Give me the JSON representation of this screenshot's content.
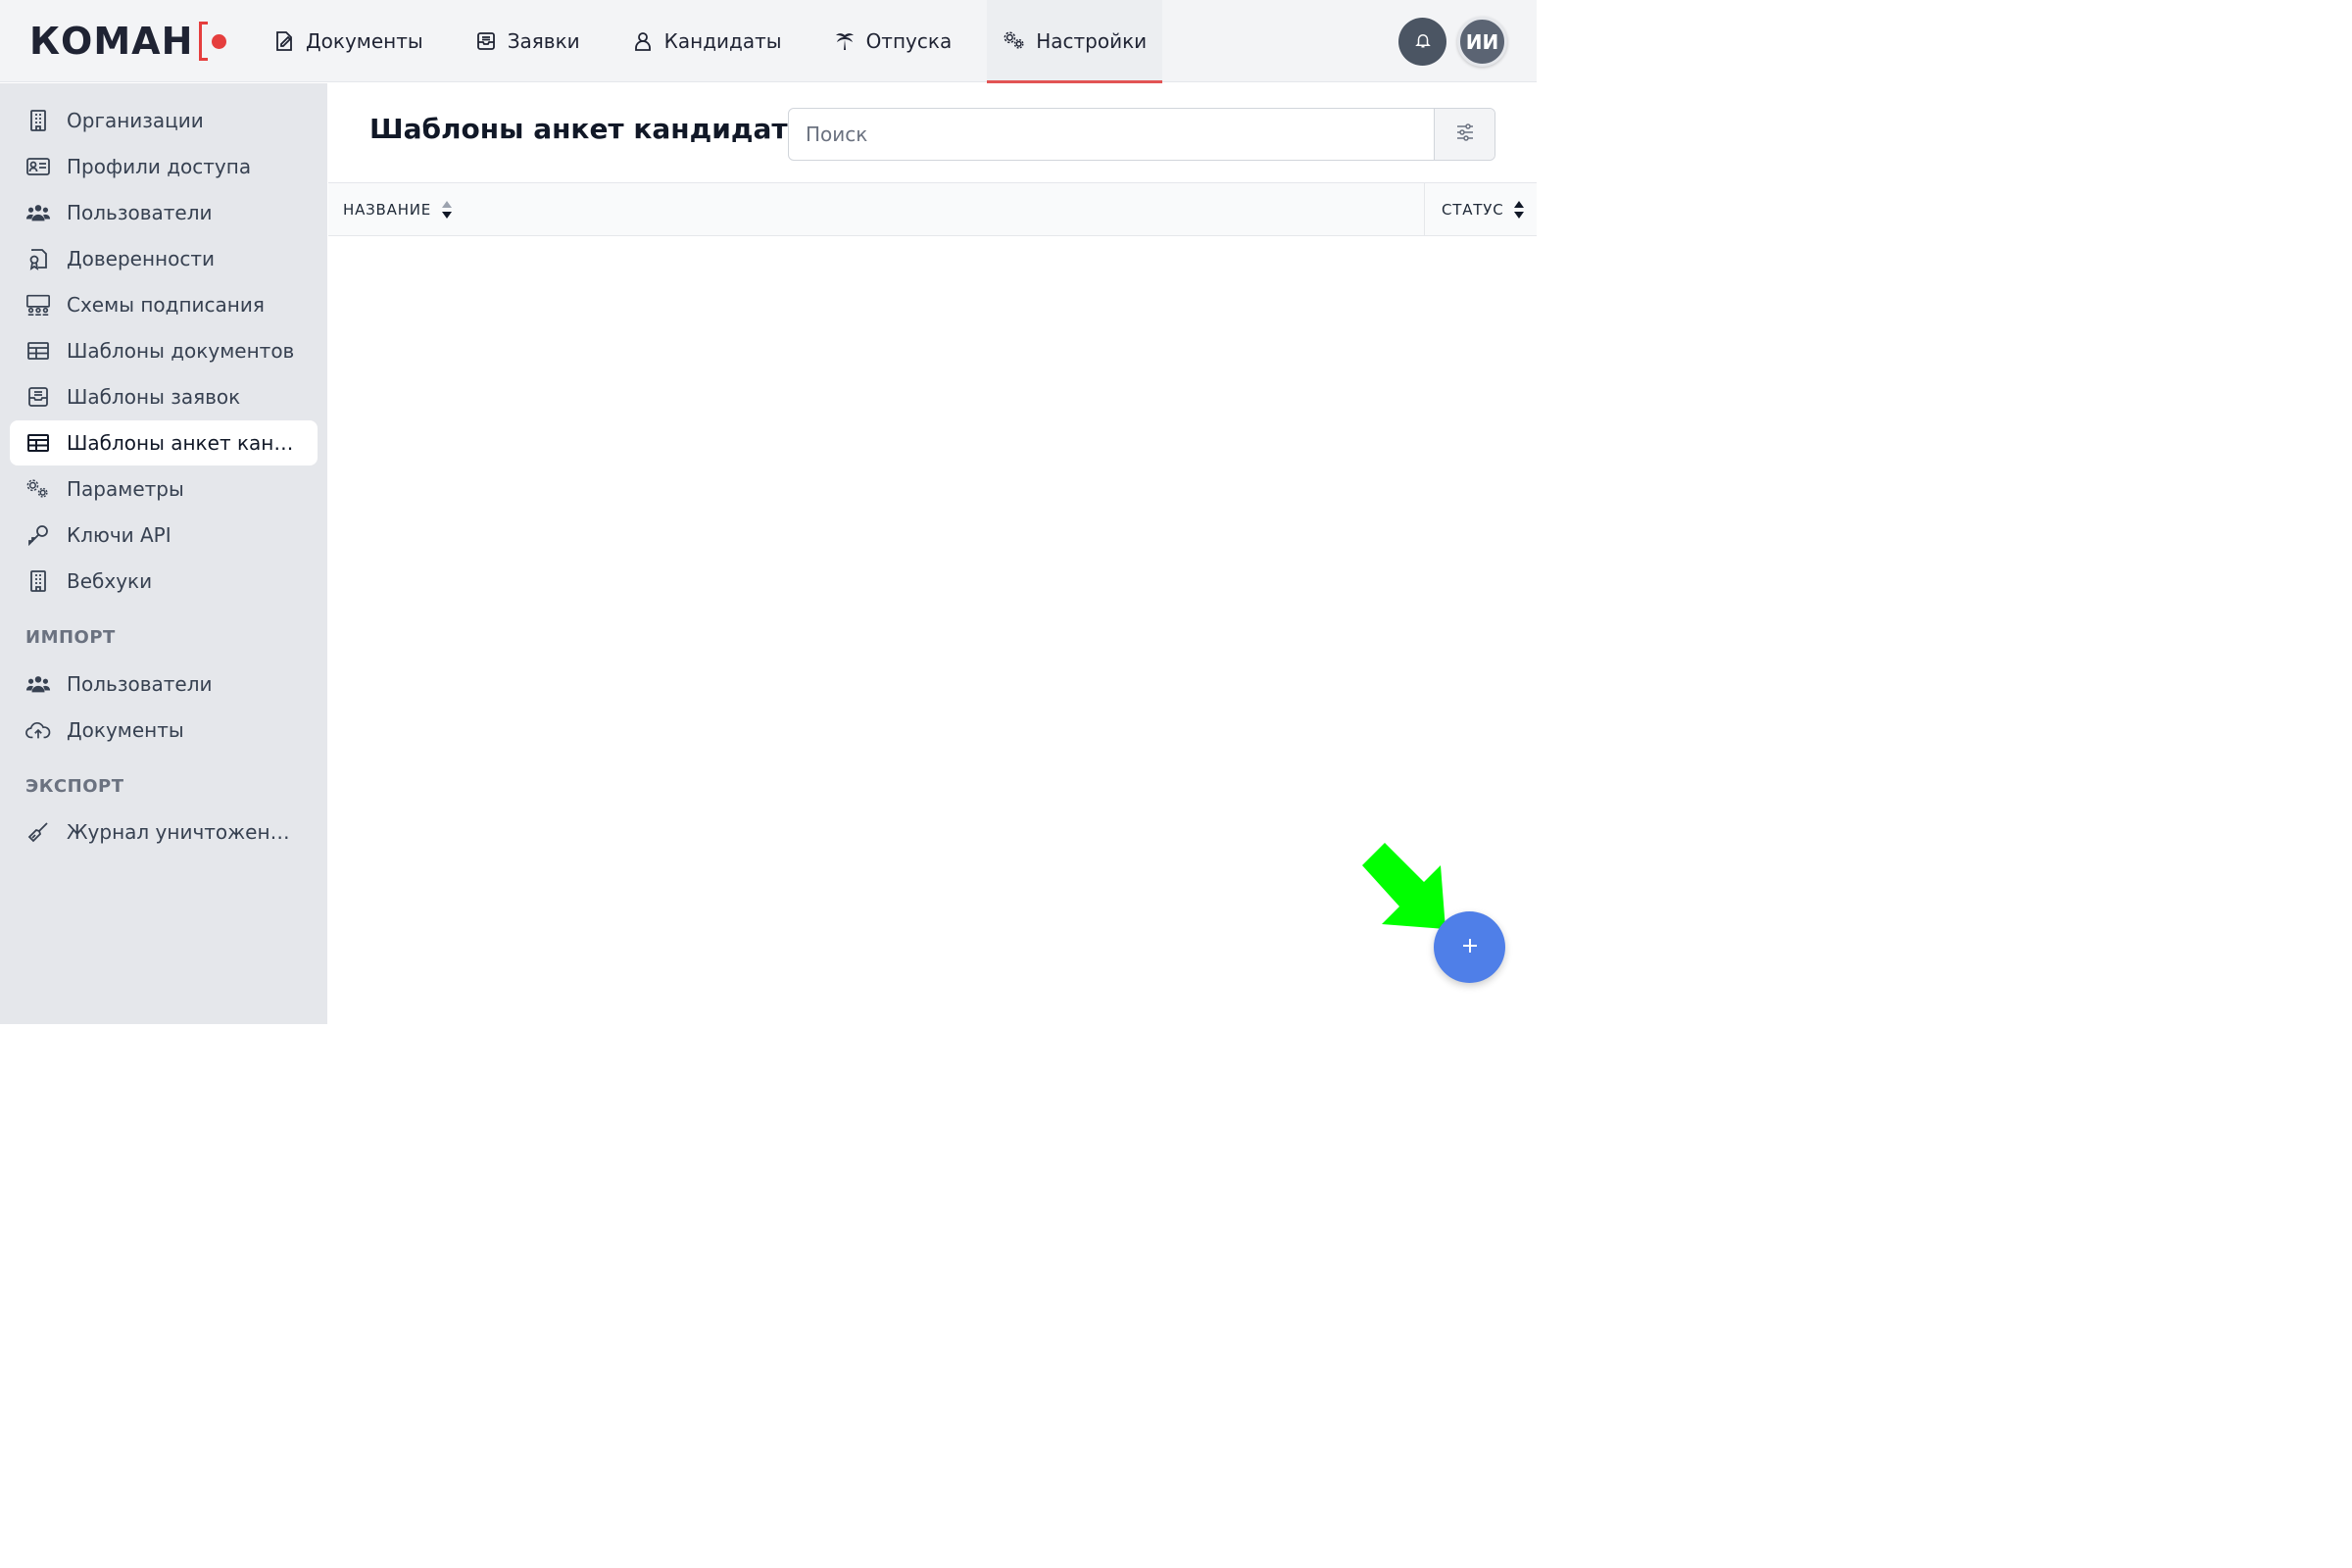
{
  "app": {
    "logo_text": "КОМАН"
  },
  "header": {
    "nav": [
      {
        "label": "Документы",
        "icon": "document-edit-icon"
      },
      {
        "label": "Заявки",
        "icon": "inbox-icon"
      },
      {
        "label": "Кандидаты",
        "icon": "candidate-icon"
      },
      {
        "label": "Отпуска",
        "icon": "palm-tree-icon"
      },
      {
        "label": "Настройки",
        "icon": "settings-gears-icon",
        "active": true
      }
    ],
    "avatar_initials": "ИИ"
  },
  "sidebar": {
    "items": [
      {
        "label": "Организации",
        "icon": "building-icon"
      },
      {
        "label": "Профили доступа",
        "icon": "id-card-icon"
      },
      {
        "label": "Пользователи",
        "icon": "users-icon"
      },
      {
        "label": "Доверенности",
        "icon": "certificate-icon"
      },
      {
        "label": "Схемы подписания",
        "icon": "signing-scheme-icon"
      },
      {
        "label": "Шаблоны документов",
        "icon": "table-icon"
      },
      {
        "label": "Шаблоны заявок",
        "icon": "inbox-icon"
      },
      {
        "label": "Шаблоны анкет кандидатов",
        "icon": "table-icon",
        "active": true
      },
      {
        "label": "Параметры",
        "icon": "gears-icon"
      },
      {
        "label": "Ключи API",
        "icon": "key-icon"
      },
      {
        "label": "Вебхуки",
        "icon": "building-icon"
      }
    ],
    "import_title": "ИМПОРТ",
    "import_items": [
      {
        "label": "Пользователи",
        "icon": "users-icon"
      },
      {
        "label": "Документы",
        "icon": "cloud-upload-icon"
      }
    ],
    "export_title": "ЭКСПОРТ",
    "export_items": [
      {
        "label": "Журнал уничтожения документов",
        "icon": "broom-icon"
      }
    ]
  },
  "main": {
    "title": "Шаблоны анкет кандидатов",
    "search": {
      "placeholder": "Поиск",
      "value": ""
    },
    "table": {
      "columns": [
        "НАЗВАНИЕ",
        "СТАТУС"
      ],
      "rows": []
    },
    "fab_label": "+"
  },
  "colors": {
    "accent": "#e25454",
    "fab": "#4f7fe8",
    "sidebar_bg": "#e5e7eb",
    "annotation_arrow": "#00ff00"
  }
}
